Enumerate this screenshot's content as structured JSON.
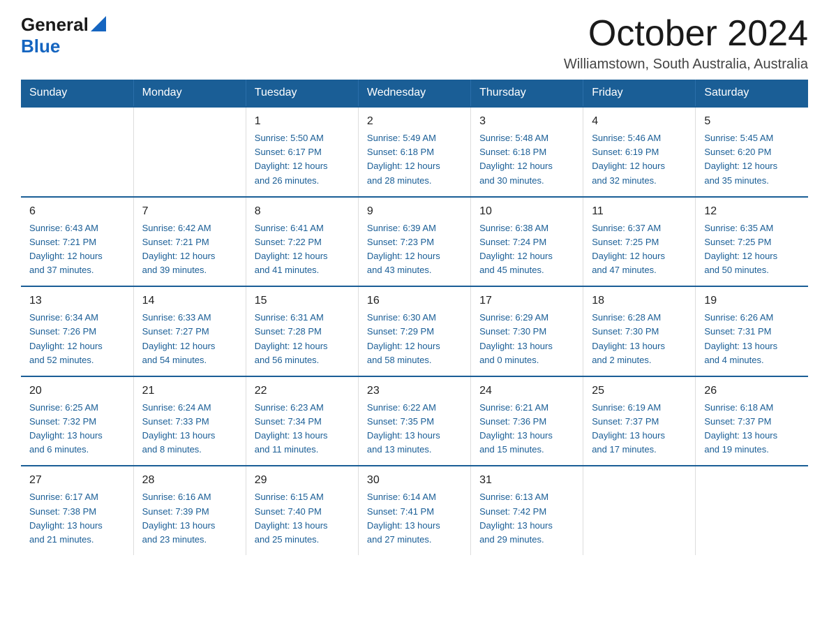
{
  "logo": {
    "text_general": "General",
    "text_blue": "Blue",
    "triangle_color": "#1565c0"
  },
  "title": "October 2024",
  "subtitle": "Williamstown, South Australia, Australia",
  "days_of_week": [
    "Sunday",
    "Monday",
    "Tuesday",
    "Wednesday",
    "Thursday",
    "Friday",
    "Saturday"
  ],
  "weeks": [
    [
      {
        "day": "",
        "info": ""
      },
      {
        "day": "",
        "info": ""
      },
      {
        "day": "1",
        "info": "Sunrise: 5:50 AM\nSunset: 6:17 PM\nDaylight: 12 hours\nand 26 minutes."
      },
      {
        "day": "2",
        "info": "Sunrise: 5:49 AM\nSunset: 6:18 PM\nDaylight: 12 hours\nand 28 minutes."
      },
      {
        "day": "3",
        "info": "Sunrise: 5:48 AM\nSunset: 6:18 PM\nDaylight: 12 hours\nand 30 minutes."
      },
      {
        "day": "4",
        "info": "Sunrise: 5:46 AM\nSunset: 6:19 PM\nDaylight: 12 hours\nand 32 minutes."
      },
      {
        "day": "5",
        "info": "Sunrise: 5:45 AM\nSunset: 6:20 PM\nDaylight: 12 hours\nand 35 minutes."
      }
    ],
    [
      {
        "day": "6",
        "info": "Sunrise: 6:43 AM\nSunset: 7:21 PM\nDaylight: 12 hours\nand 37 minutes."
      },
      {
        "day": "7",
        "info": "Sunrise: 6:42 AM\nSunset: 7:21 PM\nDaylight: 12 hours\nand 39 minutes."
      },
      {
        "day": "8",
        "info": "Sunrise: 6:41 AM\nSunset: 7:22 PM\nDaylight: 12 hours\nand 41 minutes."
      },
      {
        "day": "9",
        "info": "Sunrise: 6:39 AM\nSunset: 7:23 PM\nDaylight: 12 hours\nand 43 minutes."
      },
      {
        "day": "10",
        "info": "Sunrise: 6:38 AM\nSunset: 7:24 PM\nDaylight: 12 hours\nand 45 minutes."
      },
      {
        "day": "11",
        "info": "Sunrise: 6:37 AM\nSunset: 7:25 PM\nDaylight: 12 hours\nand 47 minutes."
      },
      {
        "day": "12",
        "info": "Sunrise: 6:35 AM\nSunset: 7:25 PM\nDaylight: 12 hours\nand 50 minutes."
      }
    ],
    [
      {
        "day": "13",
        "info": "Sunrise: 6:34 AM\nSunset: 7:26 PM\nDaylight: 12 hours\nand 52 minutes."
      },
      {
        "day": "14",
        "info": "Sunrise: 6:33 AM\nSunset: 7:27 PM\nDaylight: 12 hours\nand 54 minutes."
      },
      {
        "day": "15",
        "info": "Sunrise: 6:31 AM\nSunset: 7:28 PM\nDaylight: 12 hours\nand 56 minutes."
      },
      {
        "day": "16",
        "info": "Sunrise: 6:30 AM\nSunset: 7:29 PM\nDaylight: 12 hours\nand 58 minutes."
      },
      {
        "day": "17",
        "info": "Sunrise: 6:29 AM\nSunset: 7:30 PM\nDaylight: 13 hours\nand 0 minutes."
      },
      {
        "day": "18",
        "info": "Sunrise: 6:28 AM\nSunset: 7:30 PM\nDaylight: 13 hours\nand 2 minutes."
      },
      {
        "day": "19",
        "info": "Sunrise: 6:26 AM\nSunset: 7:31 PM\nDaylight: 13 hours\nand 4 minutes."
      }
    ],
    [
      {
        "day": "20",
        "info": "Sunrise: 6:25 AM\nSunset: 7:32 PM\nDaylight: 13 hours\nand 6 minutes."
      },
      {
        "day": "21",
        "info": "Sunrise: 6:24 AM\nSunset: 7:33 PM\nDaylight: 13 hours\nand 8 minutes."
      },
      {
        "day": "22",
        "info": "Sunrise: 6:23 AM\nSunset: 7:34 PM\nDaylight: 13 hours\nand 11 minutes."
      },
      {
        "day": "23",
        "info": "Sunrise: 6:22 AM\nSunset: 7:35 PM\nDaylight: 13 hours\nand 13 minutes."
      },
      {
        "day": "24",
        "info": "Sunrise: 6:21 AM\nSunset: 7:36 PM\nDaylight: 13 hours\nand 15 minutes."
      },
      {
        "day": "25",
        "info": "Sunrise: 6:19 AM\nSunset: 7:37 PM\nDaylight: 13 hours\nand 17 minutes."
      },
      {
        "day": "26",
        "info": "Sunrise: 6:18 AM\nSunset: 7:37 PM\nDaylight: 13 hours\nand 19 minutes."
      }
    ],
    [
      {
        "day": "27",
        "info": "Sunrise: 6:17 AM\nSunset: 7:38 PM\nDaylight: 13 hours\nand 21 minutes."
      },
      {
        "day": "28",
        "info": "Sunrise: 6:16 AM\nSunset: 7:39 PM\nDaylight: 13 hours\nand 23 minutes."
      },
      {
        "day": "29",
        "info": "Sunrise: 6:15 AM\nSunset: 7:40 PM\nDaylight: 13 hours\nand 25 minutes."
      },
      {
        "day": "30",
        "info": "Sunrise: 6:14 AM\nSunset: 7:41 PM\nDaylight: 13 hours\nand 27 minutes."
      },
      {
        "day": "31",
        "info": "Sunrise: 6:13 AM\nSunset: 7:42 PM\nDaylight: 13 hours\nand 29 minutes."
      },
      {
        "day": "",
        "info": ""
      },
      {
        "day": "",
        "info": ""
      }
    ]
  ]
}
